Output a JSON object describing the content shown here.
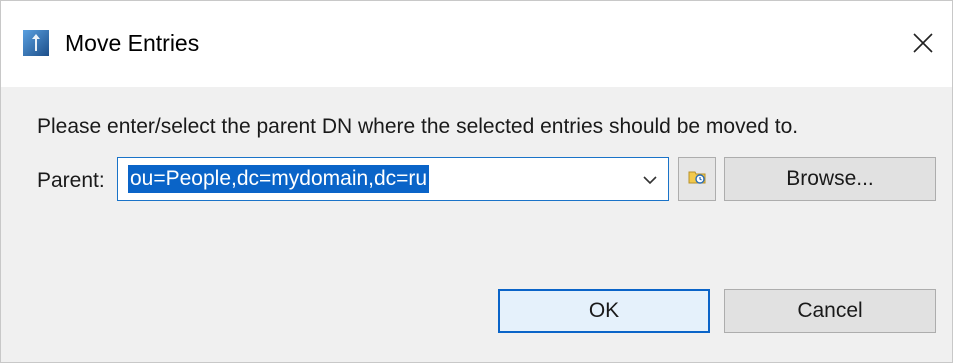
{
  "window": {
    "title": "Move Entries"
  },
  "dialog": {
    "message": "Please enter/select the parent DN where the selected entries should be moved to.",
    "parent_label": "Parent:",
    "parent_value": "ou=People,dc=mydomain,dc=ru"
  },
  "buttons": {
    "browse": "Browse...",
    "ok": "OK",
    "cancel": "Cancel"
  },
  "icons": {
    "app": "app-icon",
    "close": "close-icon",
    "dropdown": "chevron-down-icon",
    "history": "history-folder-icon"
  },
  "colors": {
    "accent": "#0a64c8",
    "background": "#f0f0f0",
    "titlebar": "#ffffff"
  }
}
